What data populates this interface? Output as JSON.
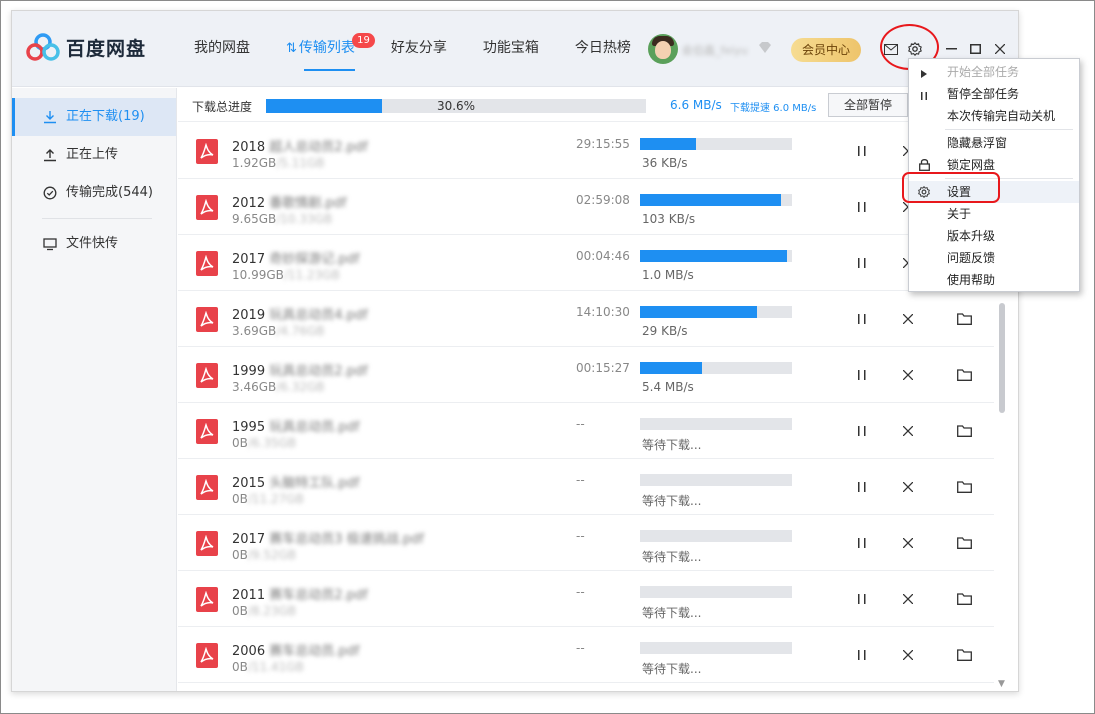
{
  "app": {
    "title": "百度网盘",
    "brand_color": "#1e8ff2"
  },
  "nav": {
    "items": [
      {
        "label": "我的网盘"
      },
      {
        "label": "传输列表",
        "badge": "19",
        "active": true
      },
      {
        "label": "好友分享"
      },
      {
        "label": "功能宝箱"
      },
      {
        "label": "今日热榜"
      }
    ]
  },
  "user": {
    "name": "兪伯鑫_feiyu",
    "vip_label": "会员中心"
  },
  "sidebar": {
    "items": [
      {
        "label": "正在下载(19)",
        "icon": "download-icon",
        "active": true
      },
      {
        "label": "正在上传",
        "icon": "upload-icon"
      },
      {
        "label": "传输完成(544)",
        "icon": "check-circle-icon"
      }
    ],
    "extra": {
      "label": "文件快传",
      "icon": "monitor-icon"
    }
  },
  "progress": {
    "label": "下载总进度",
    "percent_text": "30.6%",
    "percent": 30.6,
    "speed": "6.6 MB/s",
    "boost": "下载提速 6.0 MB/s",
    "pause_all": "全部暂停"
  },
  "files": [
    {
      "name": "2018 超人总动员2.pdf",
      "size_done": "1.92GB",
      "size_total": "/5.11GB",
      "time": "29:15:55",
      "progress": 37,
      "speed": "36 KB/s"
    },
    {
      "name": "2012 番歌情剧.pdf",
      "size_done": "9.65GB",
      "size_total": "/10.33GB",
      "time": "02:59:08",
      "progress": 93,
      "speed": "103 KB/s"
    },
    {
      "name": "2017 奇妙探游记.pdf",
      "size_done": "10.99GB",
      "size_total": "/11.23GB",
      "time": "00:04:46",
      "progress": 97,
      "speed": "1.0 MB/s"
    },
    {
      "name": "2019 玩具总动员4.pdf",
      "size_done": "3.69GB",
      "size_total": "/4.76GB",
      "time": "14:10:30",
      "progress": 77,
      "speed": "29 KB/s"
    },
    {
      "name": "1999 玩具总动员2.pdf",
      "size_done": "3.46GB",
      "size_total": "/6.32GB",
      "time": "00:15:27",
      "progress": 41,
      "speed": "5.4 MB/s"
    },
    {
      "name": "1995 玩具总动员.pdf",
      "size_done": "0B",
      "size_total": "/6.35GB",
      "time": "--",
      "progress": 0,
      "speed": "等待下载..."
    },
    {
      "name": "2015 头脑特工队.pdf",
      "size_done": "0B",
      "size_total": "/11.27GB",
      "time": "--",
      "progress": 0,
      "speed": "等待下载..."
    },
    {
      "name": "2017 赛车总动员3 极速挑战.pdf",
      "size_done": "0B",
      "size_total": "/9.52GB",
      "time": "--",
      "progress": 0,
      "speed": "等待下载..."
    },
    {
      "name": "2011 赛车总动员2.pdf",
      "size_done": "0B",
      "size_total": "/8.23GB",
      "time": "--",
      "progress": 0,
      "speed": "等待下载..."
    },
    {
      "name": "2006 赛车总动员.pdf",
      "size_done": "0B",
      "size_total": "/11.41GB",
      "time": "--",
      "progress": 0,
      "speed": "等待下载..."
    }
  ],
  "menu": {
    "items": [
      {
        "label": "开始全部任务",
        "icon": "play-icon",
        "disabled": true
      },
      {
        "label": "暂停全部任务",
        "icon": "pause-icon"
      },
      {
        "label": "本次传输完自动关机",
        "icon": ""
      },
      {
        "sep": true
      },
      {
        "label": "隐藏悬浮窗",
        "icon": ""
      },
      {
        "label": "锁定网盘",
        "icon": "lock-icon"
      },
      {
        "sep": true
      },
      {
        "label": "设置",
        "icon": "gear-icon",
        "highlighted": true
      },
      {
        "label": "关于",
        "icon": ""
      },
      {
        "label": "版本升级",
        "icon": ""
      },
      {
        "label": "问题反馈",
        "icon": ""
      },
      {
        "label": "使用帮助",
        "icon": ""
      }
    ]
  }
}
